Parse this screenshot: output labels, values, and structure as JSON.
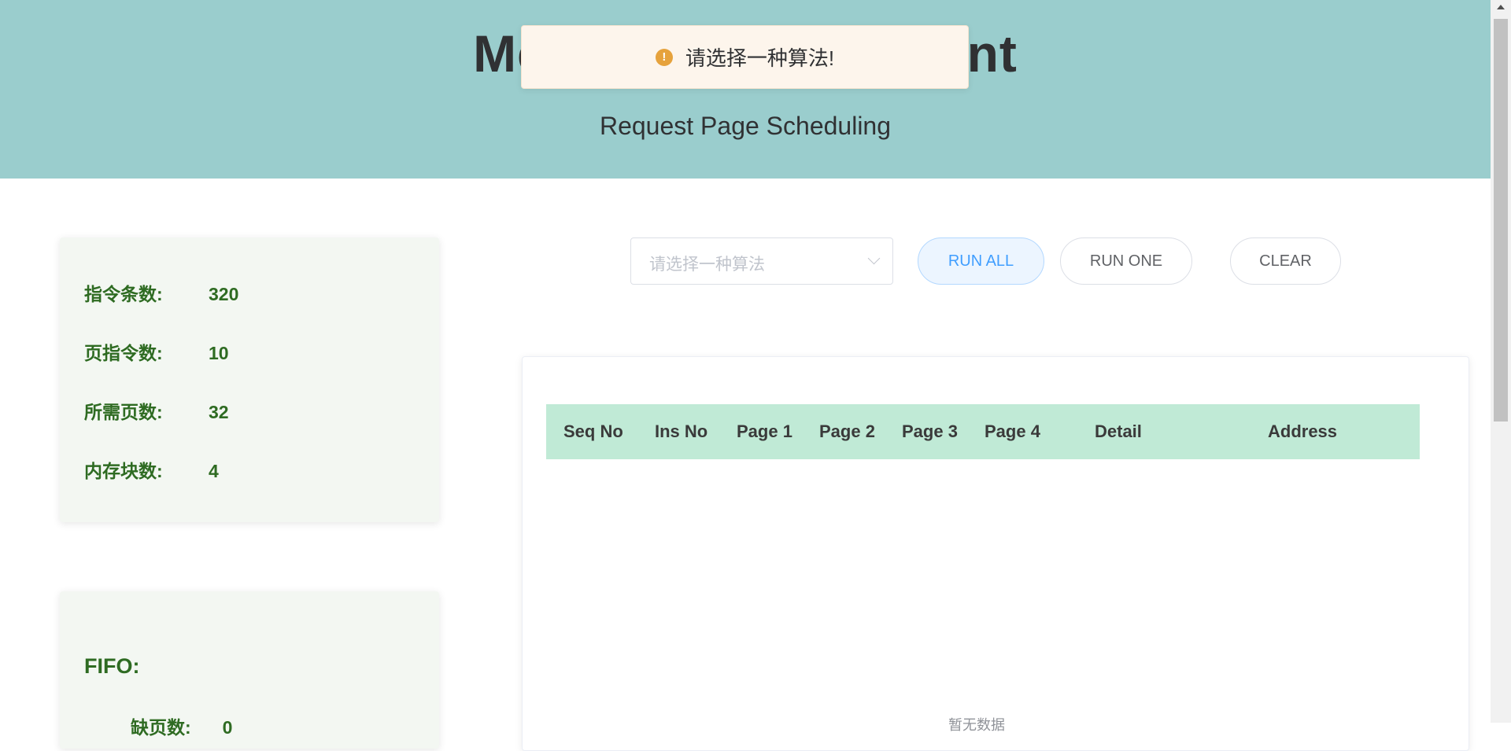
{
  "header": {
    "title": "Memory Management",
    "subtitle": "Request Page Scheduling"
  },
  "toast": {
    "message": "请选择一种算法!",
    "icon": "warning-icon"
  },
  "info_card": {
    "rows": [
      {
        "label": "指令条数:",
        "value": "320"
      },
      {
        "label": "页指令数:",
        "value": "10"
      },
      {
        "label": "所需页数:",
        "value": "32"
      },
      {
        "label": "内存块数:",
        "value": "4"
      }
    ]
  },
  "fifo_card": {
    "title": "FIFO:",
    "row_label": "缺页数:",
    "row_value": "0"
  },
  "controls": {
    "select_placeholder": "请选择一种算法",
    "run_all": "RUN ALL",
    "run_one": "RUN ONE",
    "clear": "CLEAR"
  },
  "table": {
    "columns": [
      "Seq No",
      "Ins No",
      "Page 1",
      "Page 2",
      "Page 3",
      "Page 4",
      "Detail",
      "Address"
    ],
    "empty_text": "暂无数据"
  },
  "colors": {
    "header_bg": "#9acdcd",
    "card_bg": "#f3f7f2",
    "label_green": "#2e6b22",
    "table_header_bg": "#c0ead6",
    "primary": "#409eff",
    "warning": "#e6a23c"
  }
}
